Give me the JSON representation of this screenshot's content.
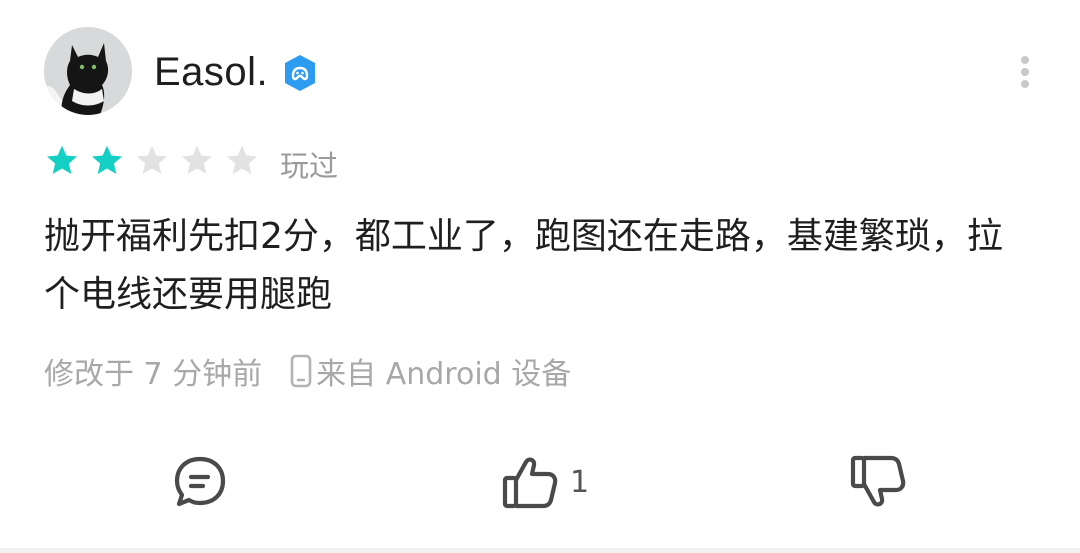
{
  "review": {
    "author": "Easol.",
    "rating": 2,
    "max_rating": 5,
    "status": "玩过",
    "text": "抛开福利先扣2分，都工业了，跑图还在走路，基建繁琐，拉个电线还要用腿跑",
    "edited_time": "修改于 7 分钟前",
    "source": "来自 Android 设备"
  },
  "actions": {
    "like_count": "1"
  },
  "colors": {
    "star_active": "#13cfc4",
    "star_inactive": "#e2e2e2",
    "badge": "#2d9cf0",
    "meta_text": "#a8a8a8"
  },
  "icons": {
    "badge": "gamepad-badge-icon",
    "more": "more-vertical-icon",
    "device": "phone-icon",
    "comment": "comment-icon",
    "like": "thumbs-up-icon",
    "dislike": "thumbs-down-icon"
  }
}
